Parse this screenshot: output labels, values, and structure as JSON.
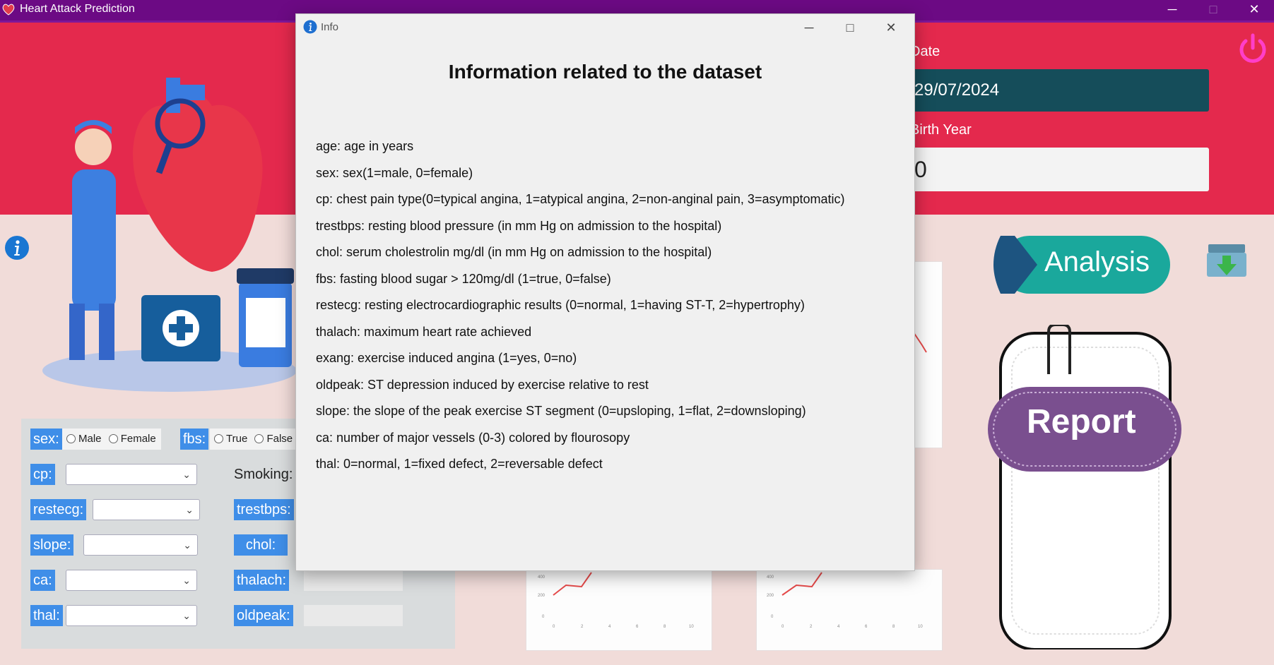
{
  "window": {
    "title": "Heart Attack Prediction",
    "controls": {
      "minimize": "─",
      "maximize": "□",
      "close": "✕"
    }
  },
  "header": {
    "date_label": "Date",
    "date_value": "29/07/2024",
    "birth_label": "Birth Year",
    "birth_value": "0"
  },
  "actions": {
    "analysis_label": "Analysis",
    "report_label": "Report"
  },
  "form": {
    "sex_label": "sex:",
    "sex_options": [
      "Male",
      "Female"
    ],
    "fbs_label": "fbs:",
    "fbs_options": [
      "True",
      "False"
    ],
    "cp_label": "cp:",
    "smoking_label": "Smoking:",
    "restecg_label": "restecg:",
    "trestbps_label": "trestbps:",
    "slope_label": "slope:",
    "chol_label": "chol:",
    "ca_label": "ca:",
    "thalach_label": "thalach:",
    "thal_label": "thal:",
    "oldpeak_label": "oldpeak:"
  },
  "chart_thumbs": {
    "y_ticks": [
      "400",
      "200",
      "0"
    ],
    "x_ticks": [
      "0",
      "2",
      "4",
      "6",
      "8",
      "10"
    ]
  },
  "modal": {
    "title": "Info",
    "heading": "Information related to the dataset",
    "lines": [
      "age: age in years",
      "sex: sex(1=male, 0=female)",
      "cp: chest pain type(0=typical angina, 1=atypical angina, 2=non-anginal pain, 3=asymptomatic)",
      "trestbps: resting blood pressure (in mm Hg on admission to the hospital)",
      "chol: serum cholestrolin mg/dl (in mm Hg on admission to the hospital)",
      "fbs: fasting blood sugar > 120mg/dl (1=true, 0=false)",
      "restecg: resting electrocardiographic results (0=normal, 1=having ST-T, 2=hypertrophy)",
      "thalach: maximum heart rate achieved",
      "exang: exercise induced angina (1=yes, 0=no)",
      "oldpeak: ST depression induced by exercise relative to rest",
      "slope: the slope of the peak exercise ST segment (0=upsloping, 1=flat, 2=downsloping)",
      "ca: number of major vessels (0-3) colored by flourosopy",
      "thal: 0=normal, 1=fixed defect, 2=reversable defect"
    ]
  },
  "colors": {
    "titlebar": "#6c0a84",
    "header_band": "#e4294d",
    "date_box": "#154d5a",
    "label_blue": "#3f8ee8",
    "analysis_teal": "#1aa89c",
    "report_purple": "#7a4f8f"
  }
}
